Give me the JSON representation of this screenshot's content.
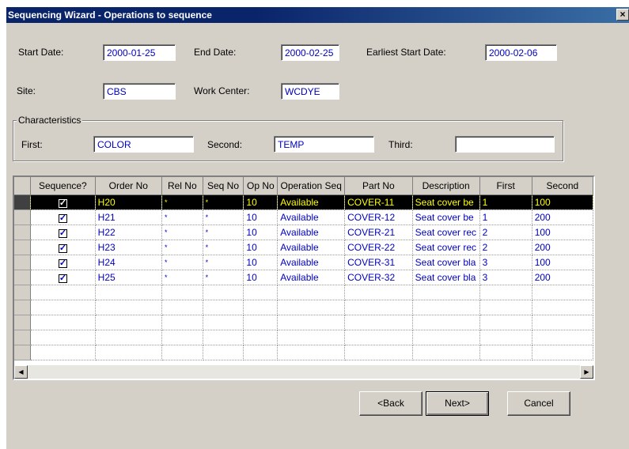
{
  "window": {
    "title": "Sequencing Wizard - Operations to sequence",
    "close_glyph": "×"
  },
  "form": {
    "start_date_label": "Start Date:",
    "start_date": "2000-01-25",
    "end_date_label": "End Date:",
    "end_date": "2000-02-25",
    "earliest_label": "Earliest Start Date:",
    "earliest": "2000-02-06",
    "site_label": "Site:",
    "site": "CBS",
    "work_center_label": "Work Center:",
    "work_center": "WCDYE"
  },
  "characteristics": {
    "legend": "Characteristics",
    "first_label": "First:",
    "first": "COLOR",
    "second_label": "Second:",
    "second": "TEMP",
    "third_label": "Third:",
    "third": ""
  },
  "grid": {
    "columns": [
      "Sequence?",
      "Order No",
      "Rel No",
      "Seq No",
      "Op No",
      "Operation Seq",
      "Part No",
      "Description",
      "First",
      "Second"
    ],
    "rows": [
      {
        "checked": "✓",
        "order": "H20",
        "rel": "*",
        "seq": "*",
        "op": "10",
        "opseq": "Available",
        "part": "COVER-11",
        "desc": "Seat cover be",
        "first": "1",
        "second": "100"
      },
      {
        "checked": "✓",
        "order": "H21",
        "rel": "*",
        "seq": "*",
        "op": "10",
        "opseq": "Available",
        "part": "COVER-12",
        "desc": "Seat cover be",
        "first": "1",
        "second": "200"
      },
      {
        "checked": "✓",
        "order": "H22",
        "rel": "*",
        "seq": "*",
        "op": "10",
        "opseq": "Available",
        "part": "COVER-21",
        "desc": "Seat cover rec",
        "first": "2",
        "second": "100"
      },
      {
        "checked": "✓",
        "order": "H23",
        "rel": "*",
        "seq": "*",
        "op": "10",
        "opseq": "Available",
        "part": "COVER-22",
        "desc": "Seat cover rec",
        "first": "2",
        "second": "200"
      },
      {
        "checked": "✓",
        "order": "H24",
        "rel": "*",
        "seq": "*",
        "op": "10",
        "opseq": "Available",
        "part": "COVER-31",
        "desc": "Seat cover bla",
        "first": "3",
        "second": "100"
      },
      {
        "checked": "✓",
        "order": "H25",
        "rel": "*",
        "seq": "*",
        "op": "10",
        "opseq": "Available",
        "part": "COVER-32",
        "desc": "Seat cover bla",
        "first": "3",
        "second": "200"
      }
    ],
    "selected_row": 0,
    "empty_rows": 5
  },
  "scroll": {
    "left_glyph": "◀",
    "right_glyph": "▶"
  },
  "buttons": {
    "back": "<Back",
    "next": "Next>",
    "cancel": "Cancel"
  }
}
